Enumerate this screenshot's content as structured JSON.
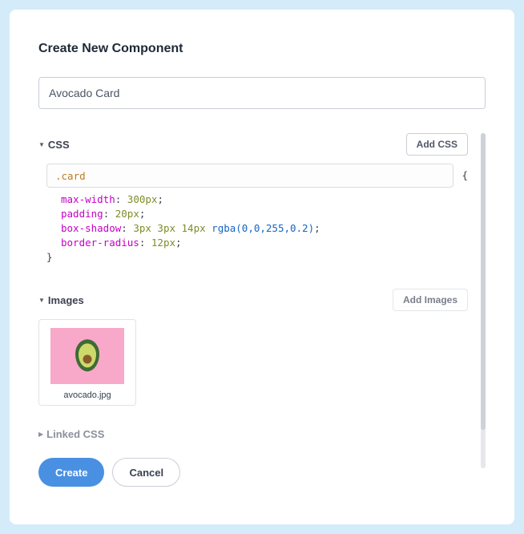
{
  "title": "Create New Component",
  "nameInput": {
    "value": "Avocado Card"
  },
  "sections": {
    "css": {
      "label": "CSS",
      "addButton": "Add CSS",
      "selector": ".card",
      "rules": [
        {
          "prop": "max-width",
          "value": "300px"
        },
        {
          "prop": "padding",
          "value": "20px"
        },
        {
          "prop": "box-shadow",
          "value_a": "3px 3px 14px ",
          "value_b": "rgba(0,0,255,0.2)"
        },
        {
          "prop": "border-radius",
          "value": "12px"
        }
      ]
    },
    "images": {
      "label": "Images",
      "addButton": "Add Images",
      "items": [
        {
          "filename": "avocado.jpg"
        }
      ]
    },
    "linkedCss": {
      "label": "Linked CSS"
    }
  },
  "footer": {
    "create": "Create",
    "cancel": "Cancel"
  }
}
